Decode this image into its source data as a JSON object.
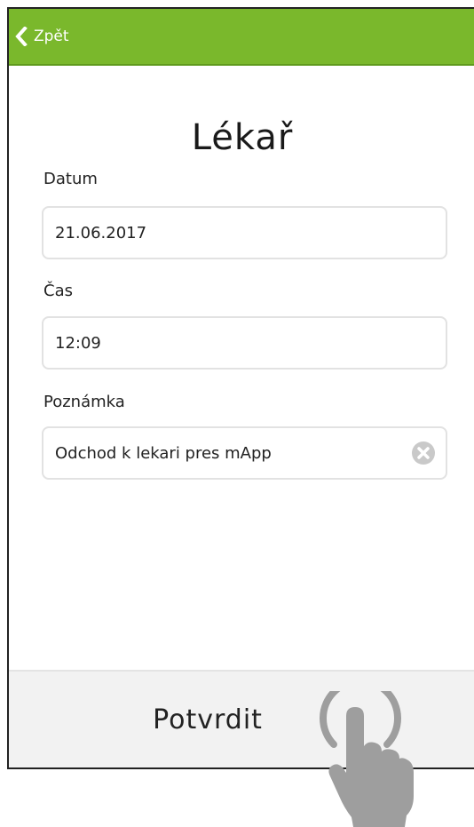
{
  "header": {
    "back_label": "Zpět",
    "back_icon": "chevron-left-icon",
    "color": "#7ab82c"
  },
  "page": {
    "title": "Lékař"
  },
  "form": {
    "date": {
      "label": "Datum",
      "value": "21.06.2017"
    },
    "time": {
      "label": "Čas",
      "value": "12:09"
    },
    "note": {
      "label": "Poznámka",
      "value": "Odchod k lekari pres mApp",
      "clear_icon": "clear-circle-icon"
    }
  },
  "footer": {
    "confirm_label": "Potvrdit",
    "gesture_icon": "tap-hand-icon"
  }
}
